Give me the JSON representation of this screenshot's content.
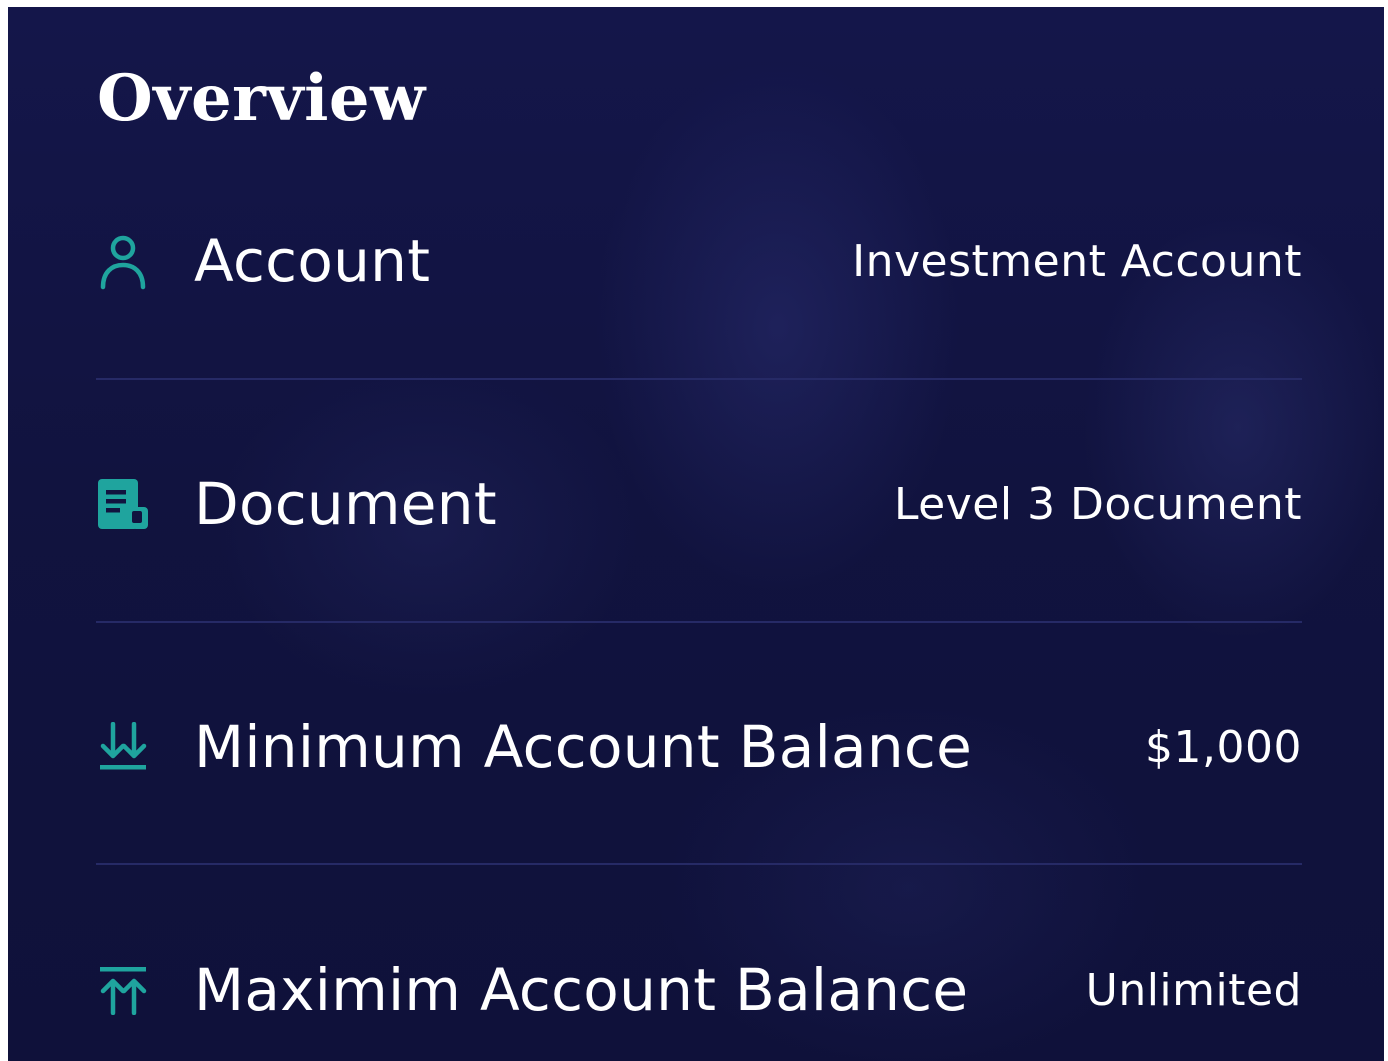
{
  "overview": {
    "title": "Overview",
    "accent_color": "#1fa49e",
    "rows": [
      {
        "icon": "user-icon",
        "label": "Account",
        "value": "Investment Account"
      },
      {
        "icon": "document-icon",
        "label": "Document",
        "value": "Level 3 Document"
      },
      {
        "icon": "arrows-down-icon",
        "label": "Minimum Account Balance",
        "value": "$1,000"
      },
      {
        "icon": "arrows-up-icon",
        "label": "Maximim Account Balance",
        "value": "Unlimited"
      }
    ]
  }
}
